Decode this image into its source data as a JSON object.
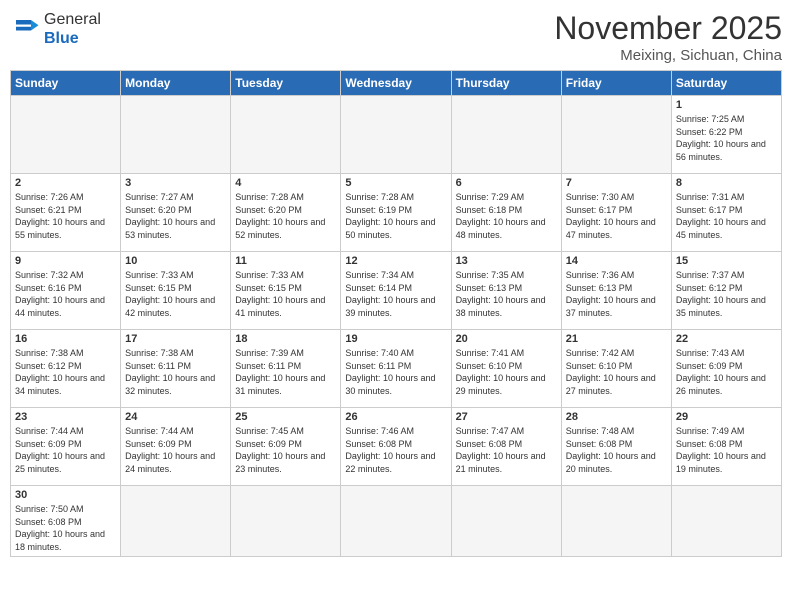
{
  "header": {
    "logo_general": "General",
    "logo_blue": "Blue",
    "month": "November 2025",
    "location": "Meixing, Sichuan, China"
  },
  "days_of_week": [
    "Sunday",
    "Monday",
    "Tuesday",
    "Wednesday",
    "Thursday",
    "Friday",
    "Saturday"
  ],
  "weeks": [
    [
      {
        "day": "",
        "info": ""
      },
      {
        "day": "",
        "info": ""
      },
      {
        "day": "",
        "info": ""
      },
      {
        "day": "",
        "info": ""
      },
      {
        "day": "",
        "info": ""
      },
      {
        "day": "",
        "info": ""
      },
      {
        "day": "1",
        "info": "Sunrise: 7:25 AM\nSunset: 6:22 PM\nDaylight: 10 hours and 56 minutes."
      }
    ],
    [
      {
        "day": "2",
        "info": "Sunrise: 7:26 AM\nSunset: 6:21 PM\nDaylight: 10 hours and 55 minutes."
      },
      {
        "day": "3",
        "info": "Sunrise: 7:27 AM\nSunset: 6:20 PM\nDaylight: 10 hours and 53 minutes."
      },
      {
        "day": "4",
        "info": "Sunrise: 7:28 AM\nSunset: 6:20 PM\nDaylight: 10 hours and 52 minutes."
      },
      {
        "day": "5",
        "info": "Sunrise: 7:28 AM\nSunset: 6:19 PM\nDaylight: 10 hours and 50 minutes."
      },
      {
        "day": "6",
        "info": "Sunrise: 7:29 AM\nSunset: 6:18 PM\nDaylight: 10 hours and 48 minutes."
      },
      {
        "day": "7",
        "info": "Sunrise: 7:30 AM\nSunset: 6:17 PM\nDaylight: 10 hours and 47 minutes."
      },
      {
        "day": "8",
        "info": "Sunrise: 7:31 AM\nSunset: 6:17 PM\nDaylight: 10 hours and 45 minutes."
      }
    ],
    [
      {
        "day": "9",
        "info": "Sunrise: 7:32 AM\nSunset: 6:16 PM\nDaylight: 10 hours and 44 minutes."
      },
      {
        "day": "10",
        "info": "Sunrise: 7:33 AM\nSunset: 6:15 PM\nDaylight: 10 hours and 42 minutes."
      },
      {
        "day": "11",
        "info": "Sunrise: 7:33 AM\nSunset: 6:15 PM\nDaylight: 10 hours and 41 minutes."
      },
      {
        "day": "12",
        "info": "Sunrise: 7:34 AM\nSunset: 6:14 PM\nDaylight: 10 hours and 39 minutes."
      },
      {
        "day": "13",
        "info": "Sunrise: 7:35 AM\nSunset: 6:13 PM\nDaylight: 10 hours and 38 minutes."
      },
      {
        "day": "14",
        "info": "Sunrise: 7:36 AM\nSunset: 6:13 PM\nDaylight: 10 hours and 37 minutes."
      },
      {
        "day": "15",
        "info": "Sunrise: 7:37 AM\nSunset: 6:12 PM\nDaylight: 10 hours and 35 minutes."
      }
    ],
    [
      {
        "day": "16",
        "info": "Sunrise: 7:38 AM\nSunset: 6:12 PM\nDaylight: 10 hours and 34 minutes."
      },
      {
        "day": "17",
        "info": "Sunrise: 7:38 AM\nSunset: 6:11 PM\nDaylight: 10 hours and 32 minutes."
      },
      {
        "day": "18",
        "info": "Sunrise: 7:39 AM\nSunset: 6:11 PM\nDaylight: 10 hours and 31 minutes."
      },
      {
        "day": "19",
        "info": "Sunrise: 7:40 AM\nSunset: 6:11 PM\nDaylight: 10 hours and 30 minutes."
      },
      {
        "day": "20",
        "info": "Sunrise: 7:41 AM\nSunset: 6:10 PM\nDaylight: 10 hours and 29 minutes."
      },
      {
        "day": "21",
        "info": "Sunrise: 7:42 AM\nSunset: 6:10 PM\nDaylight: 10 hours and 27 minutes."
      },
      {
        "day": "22",
        "info": "Sunrise: 7:43 AM\nSunset: 6:09 PM\nDaylight: 10 hours and 26 minutes."
      }
    ],
    [
      {
        "day": "23",
        "info": "Sunrise: 7:44 AM\nSunset: 6:09 PM\nDaylight: 10 hours and 25 minutes."
      },
      {
        "day": "24",
        "info": "Sunrise: 7:44 AM\nSunset: 6:09 PM\nDaylight: 10 hours and 24 minutes."
      },
      {
        "day": "25",
        "info": "Sunrise: 7:45 AM\nSunset: 6:09 PM\nDaylight: 10 hours and 23 minutes."
      },
      {
        "day": "26",
        "info": "Sunrise: 7:46 AM\nSunset: 6:08 PM\nDaylight: 10 hours and 22 minutes."
      },
      {
        "day": "27",
        "info": "Sunrise: 7:47 AM\nSunset: 6:08 PM\nDaylight: 10 hours and 21 minutes."
      },
      {
        "day": "28",
        "info": "Sunrise: 7:48 AM\nSunset: 6:08 PM\nDaylight: 10 hours and 20 minutes."
      },
      {
        "day": "29",
        "info": "Sunrise: 7:49 AM\nSunset: 6:08 PM\nDaylight: 10 hours and 19 minutes."
      }
    ],
    [
      {
        "day": "30",
        "info": "Sunrise: 7:50 AM\nSunset: 6:08 PM\nDaylight: 10 hours and 18 minutes."
      },
      {
        "day": "",
        "info": ""
      },
      {
        "day": "",
        "info": ""
      },
      {
        "day": "",
        "info": ""
      },
      {
        "day": "",
        "info": ""
      },
      {
        "day": "",
        "info": ""
      },
      {
        "day": "",
        "info": ""
      }
    ]
  ]
}
